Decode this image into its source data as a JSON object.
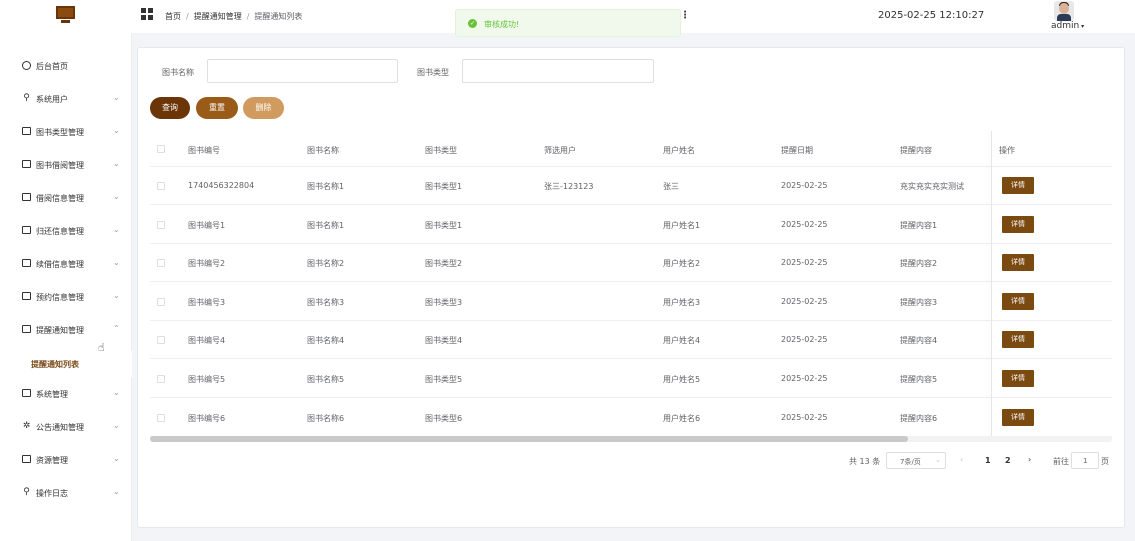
{
  "header": {
    "breadcrumb": [
      "首页",
      "提醒通知管理",
      "提醒通知列表"
    ],
    "datetime": "2025-02-25 12:10:27",
    "user": "admin",
    "toast": "审核成功!"
  },
  "sidebar": {
    "items": [
      {
        "label": "后台首页",
        "icon": "clock-icon"
      },
      {
        "label": "系统用户",
        "icon": "user-icon"
      },
      {
        "label": "图书类型管理",
        "icon": "folder-icon"
      },
      {
        "label": "图书借阅管理",
        "icon": "folder-icon"
      },
      {
        "label": "借阅信息管理",
        "icon": "folder-icon"
      },
      {
        "label": "归还信息管理",
        "icon": "folder-icon"
      },
      {
        "label": "续借信息管理",
        "icon": "folder-icon"
      },
      {
        "label": "预约信息管理",
        "icon": "folder-icon"
      },
      {
        "label": "提醒通知管理",
        "icon": "folder-icon"
      },
      {
        "label": "系统管理",
        "icon": "folder-icon"
      },
      {
        "label": "公告通知管理",
        "icon": "loading-icon"
      },
      {
        "label": "资源管理",
        "icon": "monitor-icon"
      },
      {
        "label": "操作日志",
        "icon": "user-icon"
      }
    ],
    "active_sub": "提醒通知列表"
  },
  "search": {
    "book_name_label": "图书名称",
    "book_type_label": "图书类型",
    "book_name_value": "",
    "book_type_value": ""
  },
  "buttons": {
    "query": "查询",
    "reset": "重置",
    "delete": "删除"
  },
  "colors": {
    "query": "#6b3508",
    "reset": "#9a5a18",
    "delete": "#d19a5e",
    "detail": "#7a4a10"
  },
  "table": {
    "headers": [
      "图书编号",
      "图书名称",
      "图书类型",
      "筛选用户",
      "用户姓名",
      "提醒日期",
      "提醒内容",
      "操作"
    ],
    "rows": [
      [
        "1740456322804",
        "图书名称1",
        "图书类型1",
        "张三-123123",
        "张三",
        "2025-02-25",
        "充实充实充实测试"
      ],
      [
        "图书编号1",
        "图书名称1",
        "图书类型1",
        "",
        "用户姓名1",
        "2025-02-25",
        "提醒内容1"
      ],
      [
        "图书编号2",
        "图书名称2",
        "图书类型2",
        "",
        "用户姓名2",
        "2025-02-25",
        "提醒内容2"
      ],
      [
        "图书编号3",
        "图书名称3",
        "图书类型3",
        "",
        "用户姓名3",
        "2025-02-25",
        "提醒内容3"
      ],
      [
        "图书编号4",
        "图书名称4",
        "图书类型4",
        "",
        "用户姓名4",
        "2025-02-25",
        "提醒内容4"
      ],
      [
        "图书编号5",
        "图书名称5",
        "图书类型5",
        "",
        "用户姓名5",
        "2025-02-25",
        "提醒内容5"
      ],
      [
        "图书编号6",
        "图书名称6",
        "图书类型6",
        "",
        "用户姓名6",
        "2025-02-25",
        "提醒内容6"
      ]
    ],
    "detail_label": "详情"
  },
  "pagination": {
    "total": "共 13 条",
    "page_size": "7条/页",
    "pages": [
      "1",
      "2"
    ],
    "goto_label": "前往",
    "goto_value": "1",
    "page_unit": "页"
  }
}
